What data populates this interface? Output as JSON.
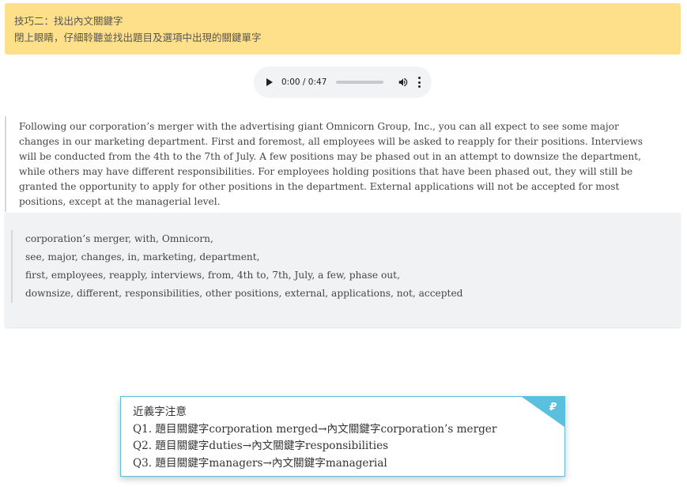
{
  "tip": {
    "title": "技巧二：找出內文關鍵字",
    "subtitle": "閉上眼睛，仔細聆聽並找出題目及選項中出現的關鍵單字"
  },
  "audio": {
    "time": "0:00 / 0:47",
    "progress": 0,
    "icons": [
      "play-icon",
      "volume-icon",
      "more-vert-icon"
    ]
  },
  "transcript": {
    "text": "Following our corporation’s merger with the advertising giant Omnicorn Group, Inc., you can all expect to see some major changes in our marketing department. First and foremost, all employees will be asked to reapply for their positions. Interviews will be conducted from the 4th to the 7th of July. A few positions may be phased out in an attempt to downsize the department, while others may have different responsibilities. For employees holding positions that have been phased out, they will still be granted the opportunity to apply for other positions in the department. External applications will not be accepted for most positions, except at the managerial level."
  },
  "keywords": {
    "lines": [
      "corporation’s merger, with, Omnicorn,",
      "see, major, changes, in, marketing, department,",
      "first, employees, reapply, interviews, from, 4th to, 7th, July, a few, phase out,",
      "downsize, different, responsibilities, other positions, external, applications, not, accepted"
    ]
  },
  "synonym_card": {
    "title": "近義字注意",
    "lines": [
      "Q1. 題目關鍵字corporation merged→內文關鍵字corporation’s merger",
      "Q2. 題目關鍵字duties→內文關鍵字responsibilities",
      "Q3. 題目關鍵字managers→內文關鍵字managerial"
    ],
    "corner_icon": "pin-icon",
    "accent_color": "#5bc0de"
  },
  "colors": {
    "tip_background": "#ffe08a",
    "panel_background": "#f1f2f4",
    "player_background": "#f1f3f4"
  }
}
